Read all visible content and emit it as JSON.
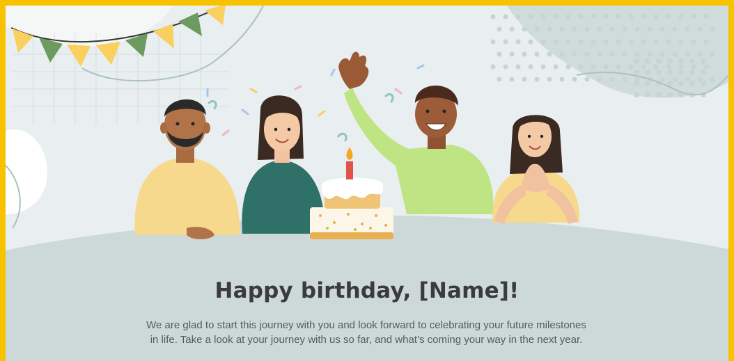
{
  "email": {
    "heading": "Happy birthday, [Name]!",
    "body": "We are glad to start this journey with you and look forward to celebrating your future milestones in life. Take a look at your journey with us so far, and what’s coming your way in the next year."
  },
  "colors": {
    "frame": "#f7c300",
    "background": "#e9eef0",
    "table": "#cdd9d9",
    "heading": "#3b3b3b",
    "body_text": "#555a5c"
  }
}
